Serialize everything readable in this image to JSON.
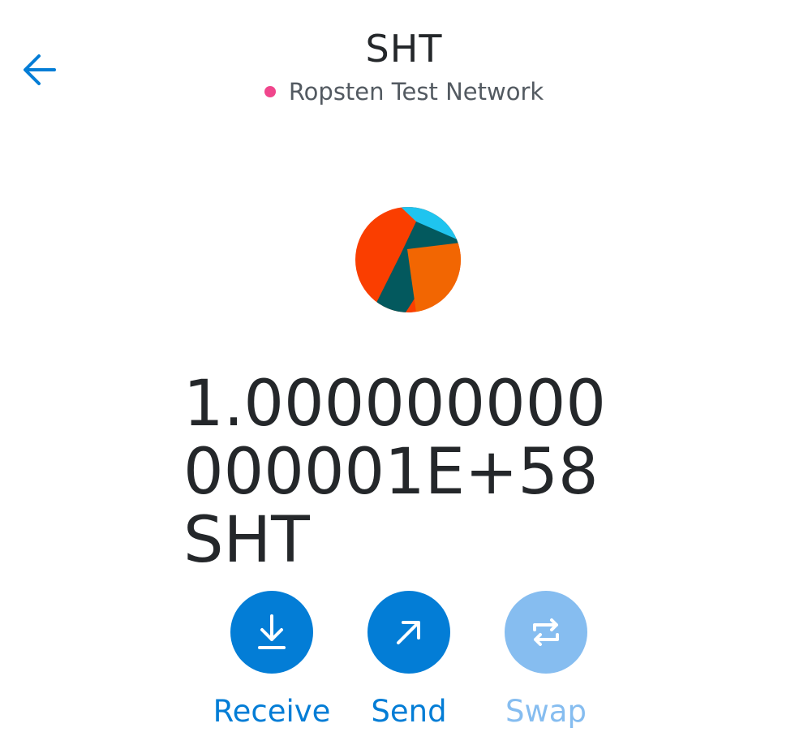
{
  "header": {
    "title": "SHT",
    "network": "Ropsten Test Network",
    "network_dot_color": "#f0468c",
    "back_icon": "arrow-left-icon"
  },
  "token": {
    "avatar_icon": "jazzicon-avatar",
    "balance": "1.000000000000001E+58",
    "symbol": "SHT"
  },
  "actions": [
    {
      "label": "Receive",
      "icon": "download-arrow-icon",
      "enabled": true
    },
    {
      "label": "Send",
      "icon": "arrow-up-right-icon",
      "enabled": true
    },
    {
      "label": "Swap",
      "icon": "swap-arrows-icon",
      "enabled": false
    }
  ],
  "colors": {
    "accent": "#037dd6",
    "accent_disabled": "#86bdf0",
    "text": "#24272a"
  }
}
